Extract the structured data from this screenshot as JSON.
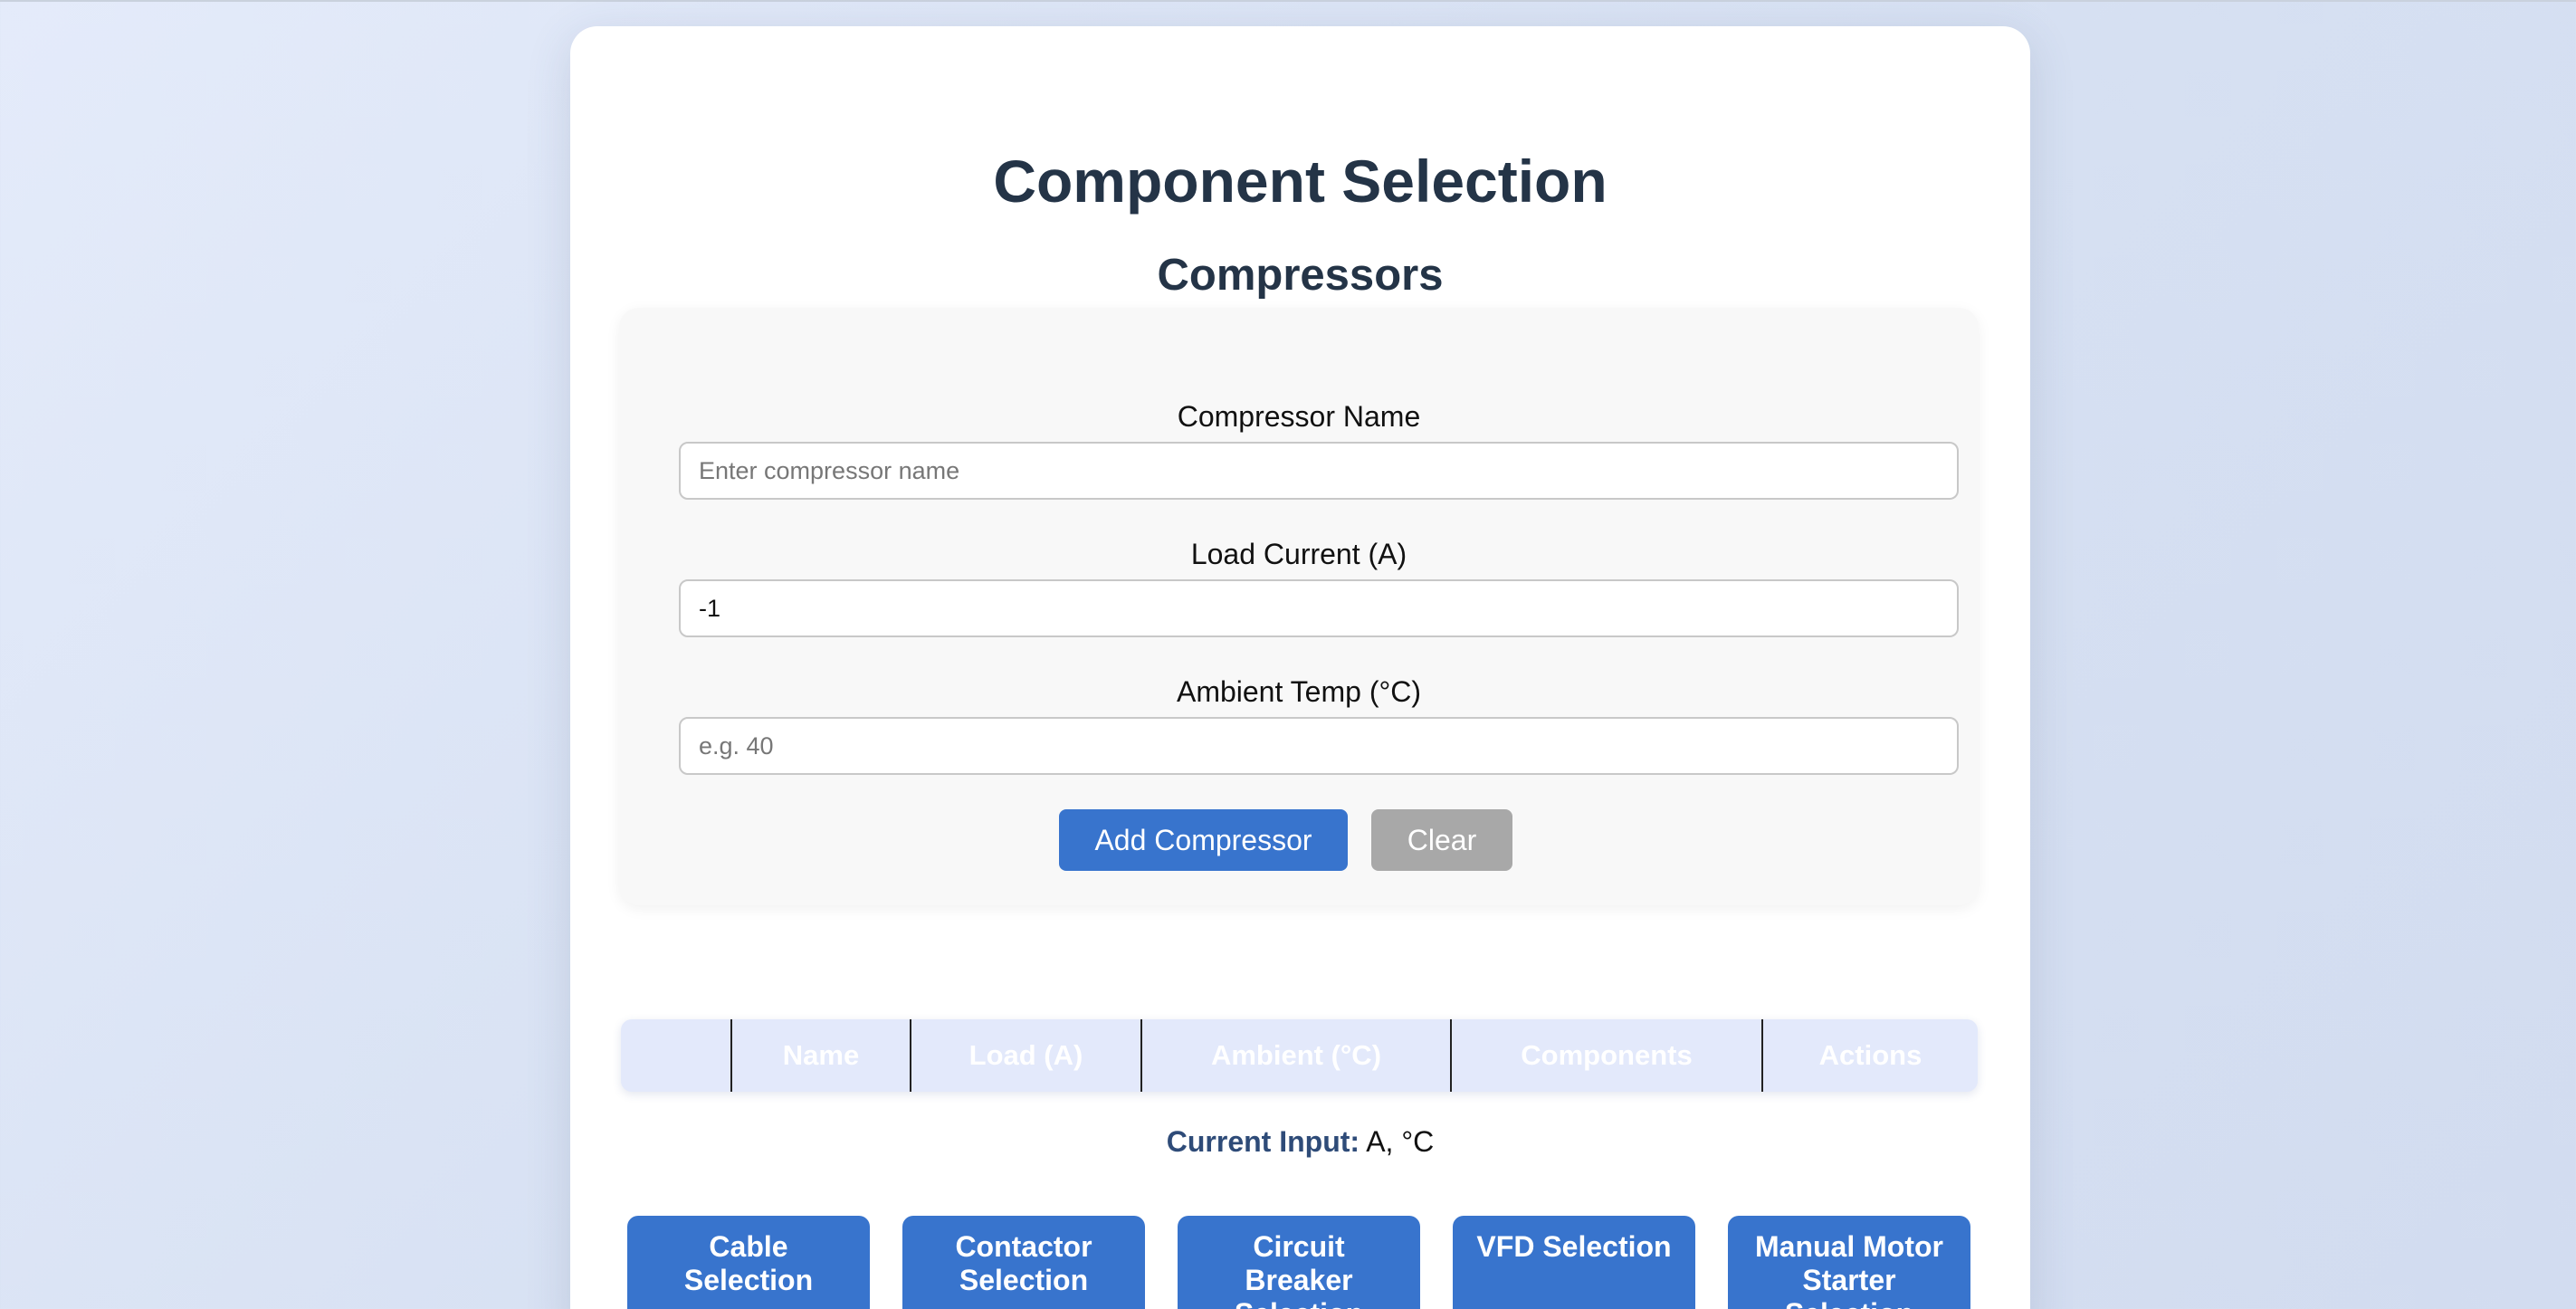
{
  "page": {
    "title": "Component Selection",
    "section_title": "Compressors"
  },
  "form": {
    "name_label": "Compressor Name",
    "name_placeholder": "Enter compressor name",
    "name_value": "",
    "load_label": "Load Current (A)",
    "load_value": "-1",
    "ambient_label": "Ambient Temp (°C)",
    "ambient_placeholder": "e.g. 40",
    "ambient_value": "",
    "add_button": "Add Compressor",
    "clear_button": "Clear"
  },
  "table": {
    "headers": [
      "",
      "Name",
      "Load (A)",
      "Ambient (°C)",
      "Components",
      "Actions"
    ]
  },
  "current_input": {
    "label": "Current Input:",
    "value": "A, °C"
  },
  "nav_buttons": [
    "Cable Selection",
    "Contactor Selection",
    "Circuit Breaker Selection",
    "VFD Selection",
    "Manual Motor Starter Selection"
  ],
  "colors": {
    "primary": "#3874cd",
    "secondary": "#a8a8a8",
    "heading": "#243447",
    "table_header_bg": "#e3e9fb"
  }
}
